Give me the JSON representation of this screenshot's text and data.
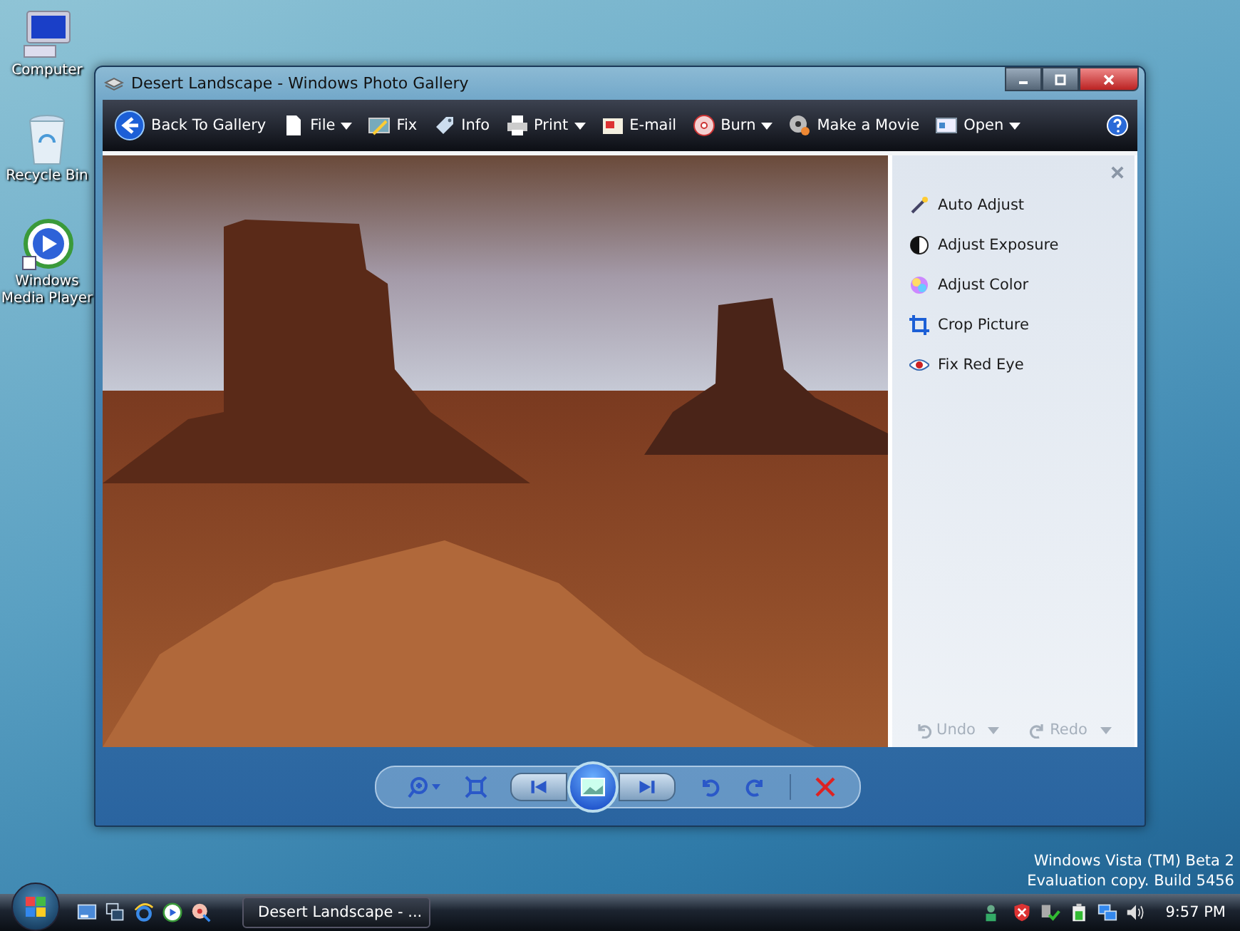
{
  "desktop_icons": [
    {
      "label": "Computer",
      "kind": "computer"
    },
    {
      "label": "Recycle Bin",
      "kind": "recycle"
    },
    {
      "label": "Windows Media Player",
      "kind": "media"
    }
  ],
  "window": {
    "title": "Desert Landscape - Windows Photo Gallery"
  },
  "toolbar": [
    {
      "label": "Back To Gallery",
      "kind": "back",
      "dropdown": false
    },
    {
      "label": "File",
      "kind": "file",
      "dropdown": true
    },
    {
      "label": "Fix",
      "kind": "fix",
      "dropdown": false
    },
    {
      "label": "Info",
      "kind": "info",
      "dropdown": false
    },
    {
      "label": "Print",
      "kind": "print",
      "dropdown": true
    },
    {
      "label": "E-mail",
      "kind": "email",
      "dropdown": false
    },
    {
      "label": "Burn",
      "kind": "burn",
      "dropdown": true
    },
    {
      "label": "Make a Movie",
      "kind": "movie",
      "dropdown": false
    },
    {
      "label": "Open",
      "kind": "open",
      "dropdown": true
    }
  ],
  "fix_panel": {
    "items": [
      {
        "label": "Auto Adjust",
        "kind": "wand"
      },
      {
        "label": "Adjust Exposure",
        "kind": "exposure"
      },
      {
        "label": "Adjust Color",
        "kind": "color"
      },
      {
        "label": "Crop Picture",
        "kind": "crop"
      },
      {
        "label": "Fix Red Eye",
        "kind": "eye"
      }
    ],
    "undo": {
      "label": "Undo",
      "disabled": true
    },
    "redo": {
      "label": "Redo",
      "disabled": true
    }
  },
  "desktop_notice": [
    "Windows Vista (TM) Beta 2",
    "Evaluation copy. Build 5456"
  ],
  "taskbar": {
    "tasks": [
      {
        "label": "Desert Landscape - ..."
      }
    ],
    "clock": "9:57 PM"
  }
}
